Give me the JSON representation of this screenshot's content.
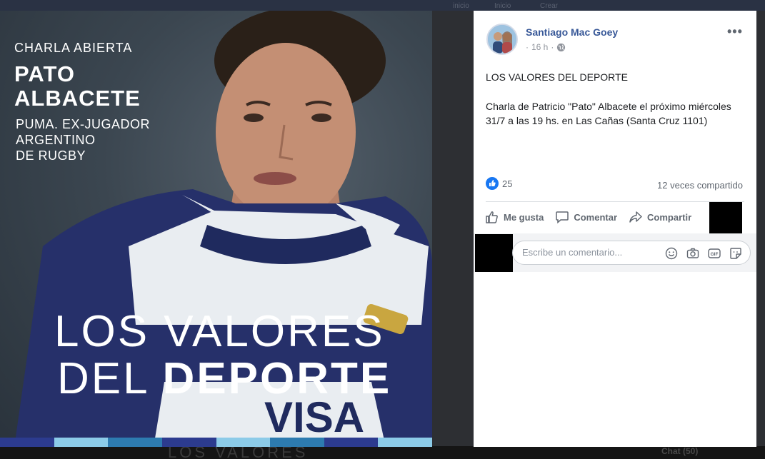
{
  "backdrop": {
    "topbar_items": [
      "inicio",
      "Inicio",
      "Crear"
    ],
    "bottom_ghost_text": "LOS VALORES",
    "chat_label": "Chat (50)"
  },
  "photo": {
    "kicker": "CHARLA ABIERTA",
    "name_line1": "PATO",
    "name_line2": "ALBACETE",
    "desc_line1": "PUMA. EX-JUGADOR",
    "desc_line2": "ARGENTINO",
    "desc_line3": "DE RUGBY",
    "big_line1": "LOS VALORES",
    "big_line2_a": "DEL ",
    "big_line2_b": "DEPORTE",
    "shirt_logo": "VISA",
    "stripe_colors": [
      "#2c3b8f",
      "#8ccbe8",
      "#2d7bb0",
      "#2c3b8f",
      "#8ccbe8",
      "#2d7bb0",
      "#2c3b8f",
      "#8ccbe8"
    ]
  },
  "post": {
    "author": "Santiago Mac Goey",
    "time": "16 h",
    "audience_icon": "globe-icon",
    "more_label": "•••",
    "title": "LOS VALORES DEL DEPORTE",
    "body": "Charla de Patricio \"Pato\" Albacete el próximo miércoles 31/7 a las 19 hs. en Las Cañas (Santa Cruz 1101)",
    "reaction_count": "25",
    "shares_text": "12 veces compartido",
    "actions": {
      "like": "Me gusta",
      "comment": "Comentar",
      "share": "Compartir"
    },
    "comment_placeholder": "Escribe un comentario...",
    "comment_icons": [
      "emoji-icon",
      "camera-icon",
      "gif-icon",
      "sticker-icon"
    ]
  },
  "colors": {
    "link_blue": "#385898",
    "like_blue": "#1877f2",
    "text_dark": "#1c1e21",
    "text_muted": "#606770"
  }
}
